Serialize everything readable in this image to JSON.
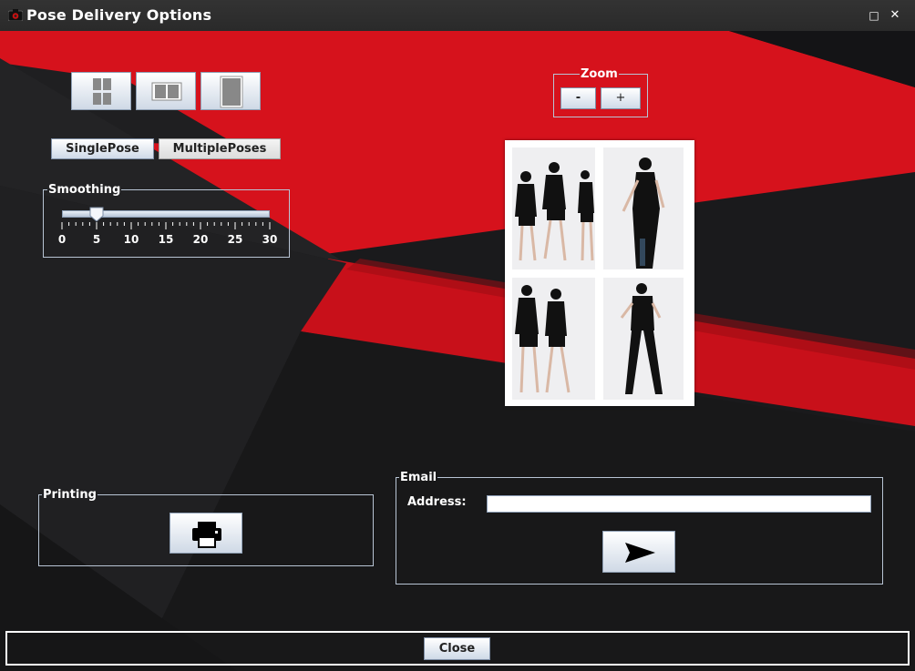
{
  "window": {
    "title": "Pose Delivery Options",
    "maximize_glyph": "□",
    "close_glyph": "✕"
  },
  "layout_buttons": [
    {
      "icon": "grid-2x2-icon"
    },
    {
      "icon": "two-panel-icon"
    },
    {
      "icon": "single-panel-icon"
    }
  ],
  "pose_buttons": {
    "single": "SinglePose",
    "multiple": "MultiplePoses"
  },
  "zoom": {
    "label": "Zoom",
    "minus": "-",
    "plus": "+"
  },
  "smoothing": {
    "label": "Smoothing",
    "value": 5,
    "min": 0,
    "max": 30,
    "tick_labels": [
      "0",
      "5",
      "10",
      "15",
      "20",
      "25",
      "30"
    ]
  },
  "printing": {
    "label": "Printing",
    "icon": "printer-icon"
  },
  "email": {
    "label": "Email",
    "address_label": "Address:",
    "address_value": "",
    "send_icon": "send-arrow-icon"
  },
  "close_button": "Close",
  "colors": {
    "accent_red": "#d6121c",
    "background": "#1b1b1d",
    "button_top": "#ffffff",
    "button_bottom": "#cfdae8"
  }
}
